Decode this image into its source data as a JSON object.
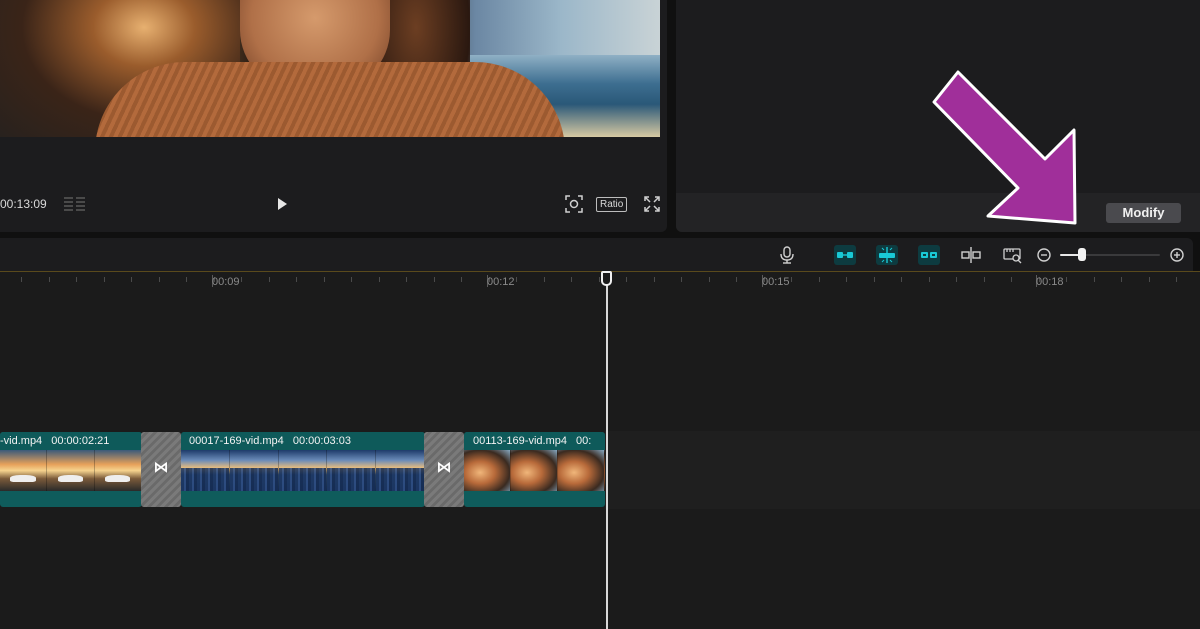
{
  "preview": {
    "timecode": "00:13:09",
    "ratio_label": "Ratio",
    "icons": {
      "grid": "grid-icon",
      "play": "play-icon",
      "fit": "fit-to-screen-icon",
      "fullscreen": "fullscreen-icon"
    }
  },
  "right_panel": {
    "modify_label": "Modify"
  },
  "toolbar": {
    "icons": [
      "microphone-icon",
      "link-clips-icon",
      "magnet-icon",
      "split-preview-icon",
      "split-icon",
      "preview-track-icon",
      "zoom-out-icon",
      "zoom-in-icon"
    ],
    "active_color": "#19c9d6"
  },
  "timeline": {
    "ruler_labels": [
      "00:09",
      "00:12",
      "00:15",
      "00:18"
    ],
    "clips": [
      {
        "name": "-vid.mp4",
        "duration": "00:00:02:21"
      },
      {
        "name": "00017-169-vid.mp4",
        "duration": "00:00:03:03"
      },
      {
        "name": "00113-169-vid.mp4",
        "duration": "00:"
      }
    ],
    "transition_glyph": "⋈"
  },
  "annotation": {
    "arrow_color": "#a02f9a"
  }
}
